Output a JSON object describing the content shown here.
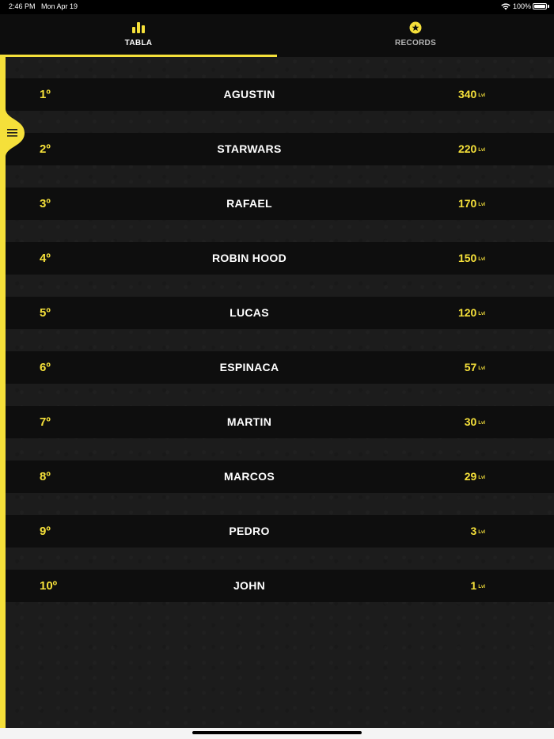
{
  "status_bar": {
    "time": "2:46 PM",
    "date": "Mon Apr 19",
    "battery": "100%"
  },
  "tabs": [
    {
      "label": "TABLA",
      "icon": "bar-chart-icon",
      "active": true
    },
    {
      "label": "RECORDS",
      "icon": "star-badge-icon",
      "active": false
    }
  ],
  "colors": {
    "accent": "#f5e03a",
    "background": "#1c1c1c",
    "row": "#0e0e0e"
  },
  "leaderboard": [
    {
      "rank": "1º",
      "name": "AGUSTIN",
      "score": "340",
      "unit": "Lvl"
    },
    {
      "rank": "2º",
      "name": "STARWARS",
      "score": "220",
      "unit": "Lvl"
    },
    {
      "rank": "3º",
      "name": "RAFAEL",
      "score": "170",
      "unit": "Lvl"
    },
    {
      "rank": "4º",
      "name": "ROBIN HOOD",
      "score": "150",
      "unit": "Lvl"
    },
    {
      "rank": "5º",
      "name": "LUCAS",
      "score": "120",
      "unit": "Lvl"
    },
    {
      "rank": "6º",
      "name": "ESPINACA",
      "score": "57",
      "unit": "Lvl"
    },
    {
      "rank": "7º",
      "name": "MARTIN",
      "score": "30",
      "unit": "Lvl"
    },
    {
      "rank": "8º",
      "name": "MARCOS",
      "score": "29",
      "unit": "Lvl"
    },
    {
      "rank": "9º",
      "name": "PEDRO",
      "score": "3",
      "unit": "Lvl"
    },
    {
      "rank": "10º",
      "name": "JOHN",
      "score": "1",
      "unit": "Lvl"
    }
  ]
}
